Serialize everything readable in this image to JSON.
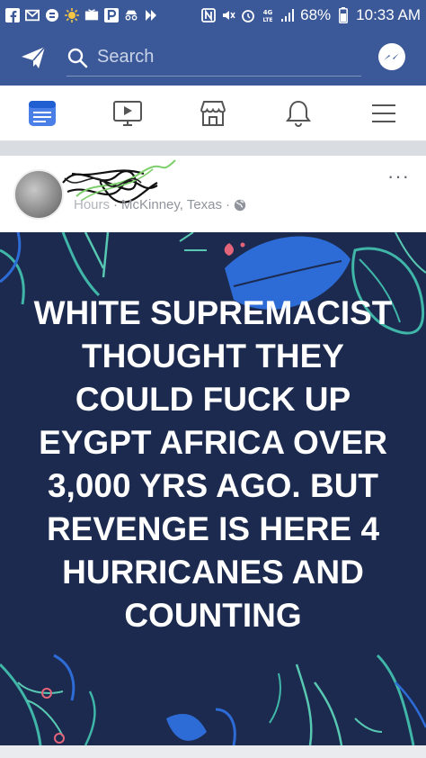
{
  "status_bar": {
    "battery": "68%",
    "time": "10:33 AM",
    "icons": [
      "facebook-icon",
      "mail-icon",
      "sync-icon",
      "sun-icon",
      "tv-icon",
      "p-icon",
      "incognito-icon",
      "flag-icon",
      "nfc-icon",
      "mute-icon",
      "alarm-icon",
      "lte-icon",
      "signal-icon",
      "battery-icon"
    ]
  },
  "header": {
    "search_placeholder": "Search",
    "accent_color": "#3b5998"
  },
  "nav": {
    "items": [
      "news-feed-icon",
      "watch-icon",
      "marketplace-icon",
      "notifications-icon",
      "menu-icon"
    ]
  },
  "post": {
    "author_partial": "Hours",
    "location": "McKinney, Texas",
    "separator": "·",
    "more": "···",
    "text": "WHITE SUPREMACIST THOUGHT THEY COULD FUCK UP EYGPT AFRICA OVER 3,000 YRS AGO. BUT REVENGE IS HERE 4 HURRICANES AND COUNTING",
    "background_color": "#1c2a4f"
  }
}
